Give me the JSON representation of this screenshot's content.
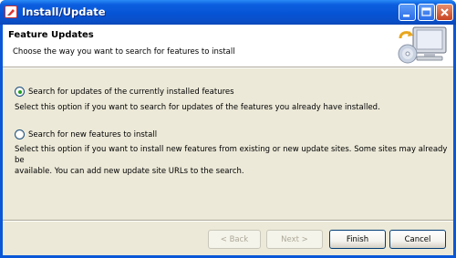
{
  "window": {
    "title": "Install/Update"
  },
  "header": {
    "title": "Feature Updates",
    "description": "Choose the way you want to search for features to install"
  },
  "options": [
    {
      "label": "Search for updates of the currently installed features",
      "selected": true,
      "description": "Select this option if you want to search for updates of the features you already have installed."
    },
    {
      "label": "Search for new features to install",
      "selected": false,
      "description_lines": [
        "Select this option if you want to install new features from existing or new update sites. Some sites may already be",
        "available. You can add new update site URLs to the search."
      ]
    }
  ],
  "buttons": {
    "back": "< Back",
    "next": "Next >",
    "finish": "Finish",
    "cancel": "Cancel"
  },
  "icons": {
    "app": "eclipse-edit-icon",
    "banner": "monitor-cd-update-icon"
  }
}
